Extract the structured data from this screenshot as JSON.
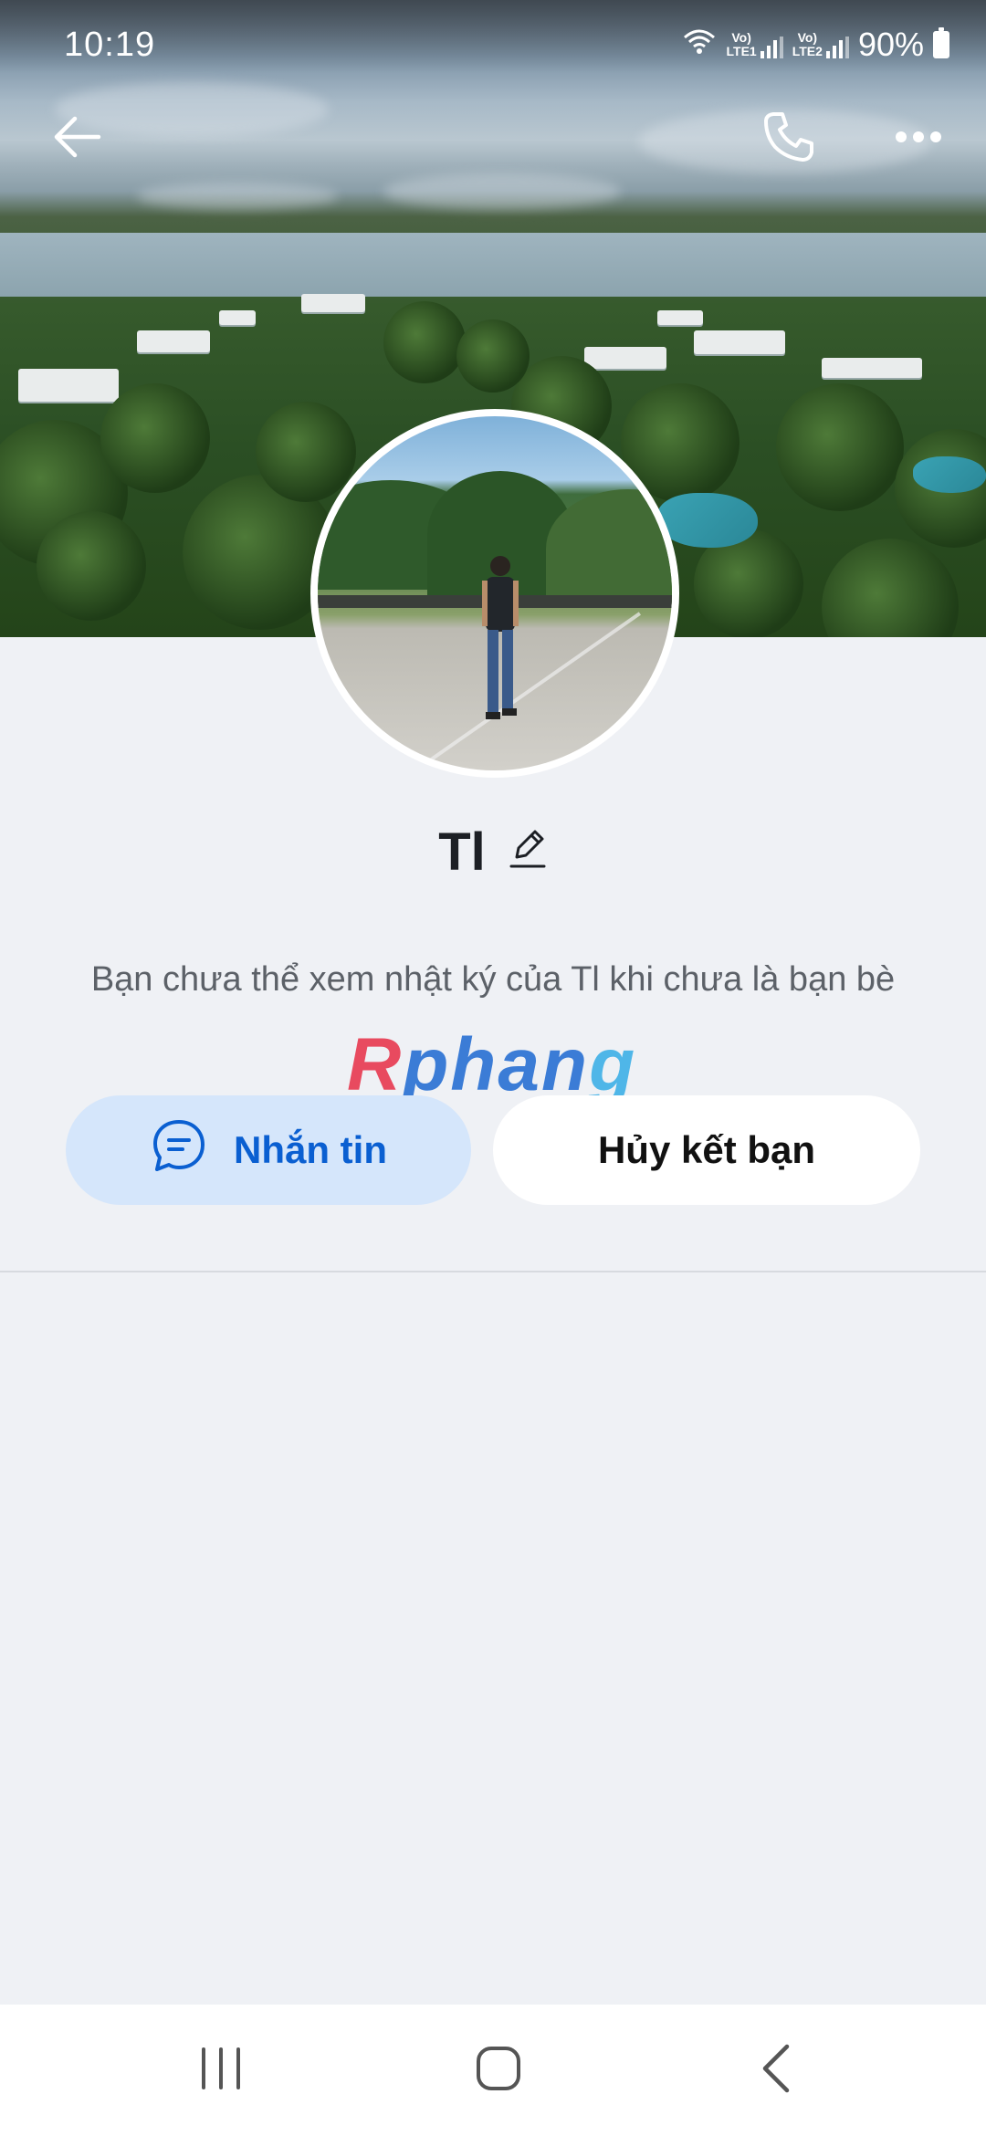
{
  "status_bar": {
    "time": "10:19",
    "sim1_label_top": "Vo)",
    "sim1_label_bottom": "LTE1",
    "sim2_label_top": "Vo)",
    "sim2_label_bottom": "LTE2",
    "battery": "90%",
    "icons": [
      "wifi-icon",
      "signal-icon",
      "battery-icon"
    ]
  },
  "header": {
    "icons": [
      "back-arrow-icon",
      "phone-call-icon",
      "more-options-icon"
    ]
  },
  "profile": {
    "name": "Tl",
    "name_edit_icon": "pencil-icon",
    "info_text": "Bạn chưa thể xem nhật ký của Tl khi chưa là bạn bè"
  },
  "watermark": {
    "part1": "R",
    "part2": "phan",
    "part3": "g"
  },
  "actions": {
    "message_label": "Nhắn tin",
    "message_icon": "chat-bubble-icon",
    "unfriend_label": "Hủy kết bạn"
  },
  "nav_bar": {
    "icons": [
      "recent-apps-icon",
      "home-icon",
      "back-icon"
    ]
  },
  "colors": {
    "accent": "#0a5fd1",
    "message_button_bg": "#d5e6fb",
    "page_bg": "#eff1f5"
  }
}
